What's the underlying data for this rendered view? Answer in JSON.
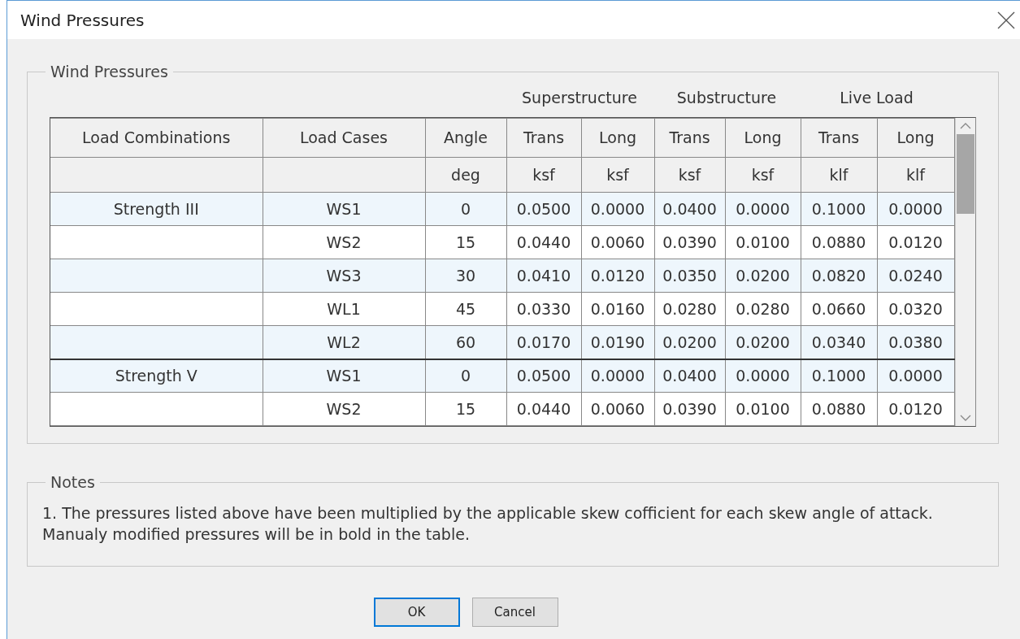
{
  "window": {
    "title": "Wind Pressures"
  },
  "wind_pressures": {
    "legend": "Wind Pressures",
    "columns": [
      {
        "label": "Load Combinations"
      },
      {
        "label": "Load Cases"
      },
      {
        "label": "Angle",
        "unit": "deg"
      }
    ],
    "column_groups": [
      {
        "label": "Superstructure",
        "columns": [
          {
            "label": "Trans",
            "unit": "ksf"
          },
          {
            "label": "Long",
            "unit": "ksf"
          }
        ]
      },
      {
        "label": "Substructure",
        "columns": [
          {
            "label": "Trans",
            "unit": "ksf"
          },
          {
            "label": "Long",
            "unit": "ksf"
          }
        ]
      },
      {
        "label": "Live Load",
        "columns": [
          {
            "label": "Trans",
            "unit": "klf"
          },
          {
            "label": "Long",
            "unit": "klf"
          }
        ]
      }
    ],
    "rows": [
      {
        "combination": "Strength III",
        "load_case": "WS1",
        "angle": "0",
        "values": [
          "0.0500",
          "0.0000",
          "0.0400",
          "0.0000",
          "0.1000",
          "0.0000"
        ]
      },
      {
        "load_case": "WS2",
        "angle": "15",
        "values": [
          "0.0440",
          "0.0060",
          "0.0390",
          "0.0100",
          "0.0880",
          "0.0120"
        ]
      },
      {
        "load_case": "WS3",
        "angle": "30",
        "values": [
          "0.0410",
          "0.0120",
          "0.0350",
          "0.0200",
          "0.0820",
          "0.0240"
        ]
      },
      {
        "load_case": "WL1",
        "angle": "45",
        "values": [
          "0.0330",
          "0.0160",
          "0.0280",
          "0.0280",
          "0.0660",
          "0.0320"
        ]
      },
      {
        "load_case": "WL2",
        "angle": "60",
        "values": [
          "0.0170",
          "0.0190",
          "0.0200",
          "0.0200",
          "0.0340",
          "0.0380"
        ]
      },
      {
        "combination": "Strength V",
        "load_case": "WS1",
        "angle": "0",
        "values": [
          "0.0500",
          "0.0000",
          "0.0400",
          "0.0000",
          "0.1000",
          "0.0000"
        ]
      },
      {
        "load_case": "WS2",
        "angle": "15",
        "values": [
          "0.0440",
          "0.0060",
          "0.0390",
          "0.0100",
          "0.0880",
          "0.0120"
        ]
      }
    ]
  },
  "notes": {
    "legend": "Notes",
    "text": "1. The pressures listed above have been multiplied by the applicable skew cofficient for each skew angle of attack. Manualy modified pressures will be in bold in the table."
  },
  "buttons": [
    {
      "label": "OK",
      "default": true
    },
    {
      "label": "Cancel",
      "default": false
    }
  ]
}
